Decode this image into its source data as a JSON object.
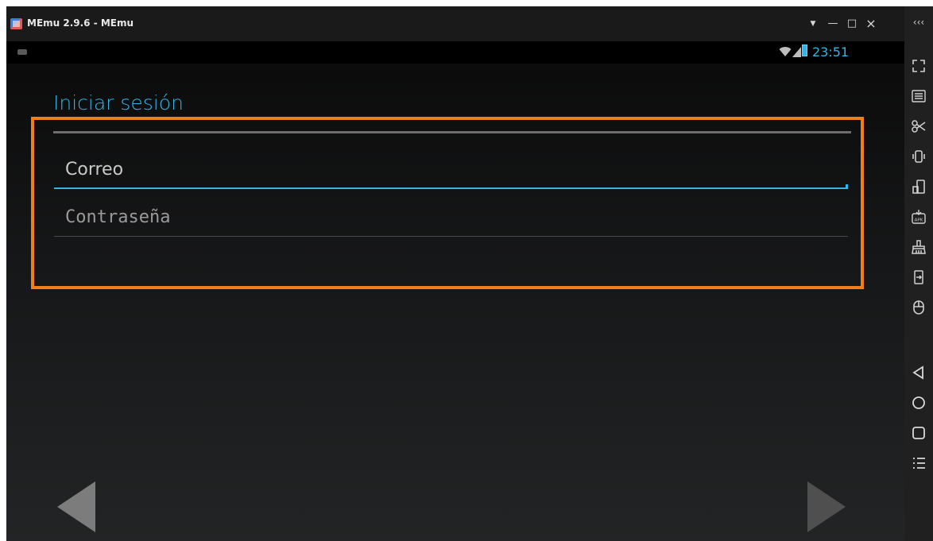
{
  "window": {
    "title": "MEmu 2.9.6 - MEmu",
    "controls": {
      "menu": "▼",
      "minimize": "—",
      "maximize": "□",
      "close": "×",
      "collapse": "‹‹‹"
    }
  },
  "status_bar": {
    "time": "23:51"
  },
  "login": {
    "title": "Iniciar sesión",
    "email_placeholder": "Correo",
    "password_placeholder": "Contraseña"
  },
  "toolbar_items": [
    "fullscreen-icon",
    "keyboard-icon",
    "scissors-icon",
    "shake-icon",
    "rotate-icon",
    "apk-install-icon",
    "clean-icon",
    "share-icon",
    "mouse-icon",
    "back-icon",
    "home-icon",
    "recents-icon",
    "menu-icon"
  ],
  "colors": {
    "accent": "#33b5e5",
    "highlight": "#f07e1a"
  }
}
